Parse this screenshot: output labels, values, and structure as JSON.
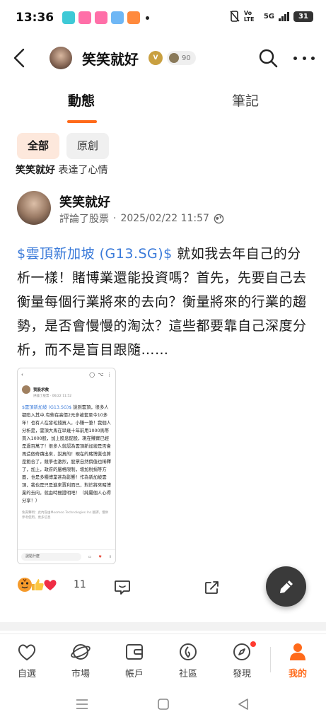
{
  "status_bar": {
    "time": "13:36",
    "network_label": "Vo LTE",
    "signal_label": "5G",
    "battery": "31"
  },
  "header": {
    "title": "笑笑就好",
    "verified_badge": "V",
    "level": "90"
  },
  "tabs": [
    {
      "label": "動態",
      "active": true
    },
    {
      "label": "筆記",
      "active": false
    }
  ],
  "filters": [
    {
      "label": "全部",
      "active": true
    },
    {
      "label": "原創",
      "active": false
    }
  ],
  "mood": {
    "user": "笑笑就好",
    "text": "表達了心情"
  },
  "post": {
    "author": "笑笑就好",
    "action": "評論了股票",
    "timestamp": "2025/02/22 11:57",
    "ticker_tag": "$雲頂新加坡 (G13.SG)$",
    "body": " 就如我去年自己的分析一樣！賭博業還能投資嗎？首先，先要自己去衡量每個行業將來的去向？衡量將來的行業的趨勢，是否會慢慢的淘汰？這些都要靠自己深度分析，而不是盲目跟隨……",
    "reaction_count": "11"
  },
  "embedded": {
    "author": "我股求救",
    "meta": "評論了股票 · 06/22 11:52",
    "tag": "$雲頂新加坡 (G13.SG)$",
    "body": " 說到雲頂，很多人都陷入其中,有些在高價2元多被套至今10多年！也有人在發毛錢買入，小賺一筆！我個人分析是，雲頂大馬在早幾十年前用1000馬幣買入1000股，加上股息配股，現在賺實已經是過百萬了！很多人就認為雲頂新加坡是否會再造個奇蹟出來，說真的！現在的賭博業也算是飽合了，競爭也激烈，股票自然價值也稀釋了，加上，政府的嚴格限制，增加稅捐等方面，也是多種博業甚為影響！作為新加坡雲頂，我也是只是進來賣利而已，對於將來賭博業的去向，就由時間證明吧！（純屬個人心得分享！）",
    "footer": "免責聲明：此內容由Moomoo Technologies Inc.翻譯，僅供參考使用。更多信息",
    "comment_placeholder": "說點什麼"
  },
  "bottom_nav": [
    {
      "label": "自選",
      "icon": "heart-icon",
      "active": false
    },
    {
      "label": "市場",
      "icon": "planet-icon",
      "active": false
    },
    {
      "label": "帳戶",
      "icon": "wallet-icon",
      "active": false
    },
    {
      "label": "社區",
      "icon": "community-icon",
      "active": false
    },
    {
      "label": "發現",
      "icon": "compass-icon",
      "active": false
    },
    {
      "label": "我的",
      "icon": "person-icon",
      "active": true
    }
  ],
  "colors": {
    "accent": "#ff6a1a",
    "link": "#3a7ad9",
    "chip_active_bg": "#fde8dc",
    "fab": "#3a3a3a"
  }
}
